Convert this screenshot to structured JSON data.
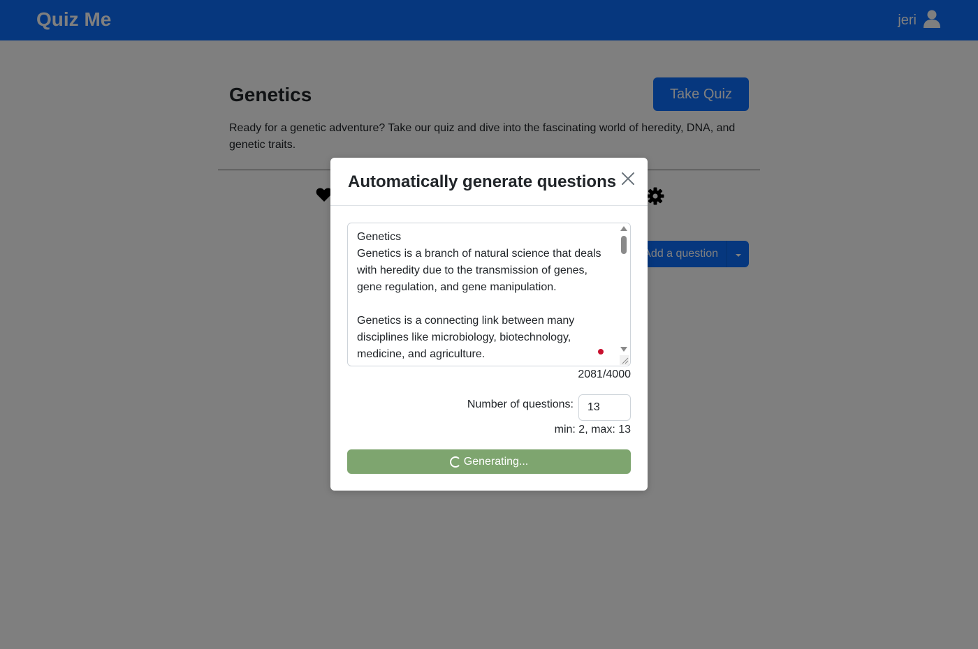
{
  "navbar": {
    "brand": "Quiz Me",
    "user_name": "jeri",
    "user_icon": "user-icon"
  },
  "quiz": {
    "title": "Genetics",
    "take_quiz_label": "Take Quiz",
    "description": "Ready for a genetic adventure? Take our quiz and dive into the fascinating world of heredity, DNA, and genetic traits.",
    "favorite_icon": "heart-icon",
    "settings_icon": "gear-icon",
    "add_question_label": "Add a question"
  },
  "modal": {
    "title": "Automatically generate questions",
    "close_icon": "close-icon",
    "source_text": "Genetics\nGenetics is a branch of natural science that deals with heredity due to the transmission of genes, gene regulation, and gene manipulation.\n\nGenetics is a connecting link between many disciplines like microbiology, biotechnology, medicine, and agriculture.",
    "char_count": "2081/4000",
    "num_questions_label": "Number of questions:",
    "num_questions_value": "13",
    "range_hint": "min: 2, max: 13",
    "generate_button_label": "Generating..."
  },
  "colors": {
    "primary": "#0d6efd",
    "generating_button": "#7ea56f",
    "backdrop": "rgba(0,0,0,0.5)"
  }
}
